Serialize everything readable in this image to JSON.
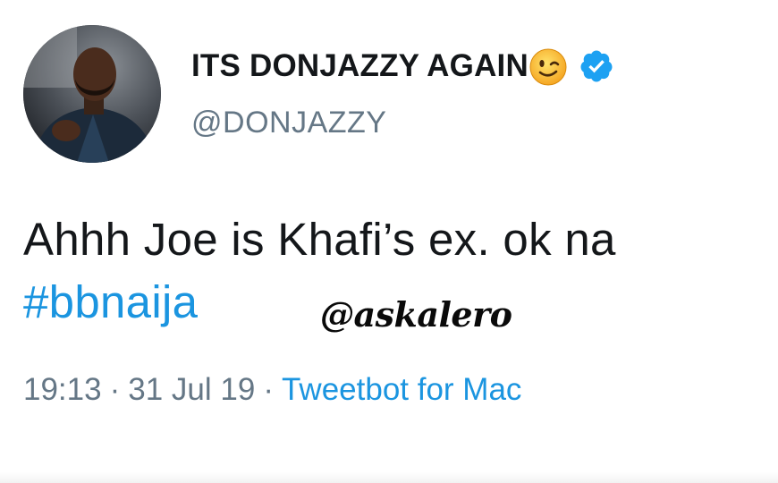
{
  "author": {
    "display_name": "ITS DONJAZZY AGAIN",
    "handle": "@DONJAZZY",
    "verified": true,
    "name_emoji": "winking-face-icon"
  },
  "tweet": {
    "text": "Ahhh Joe is Khafi’s ex. ok na",
    "hashtag": "#bbnaija"
  },
  "watermark": "@askalero",
  "meta": {
    "time": "19:13",
    "separator": "·",
    "date": "31 Jul 19",
    "source": "Tweetbot for Mac"
  },
  "colors": {
    "text": "#14171a",
    "secondary": "#657786",
    "link": "#1b95e0",
    "verified": "#1da1f2"
  }
}
